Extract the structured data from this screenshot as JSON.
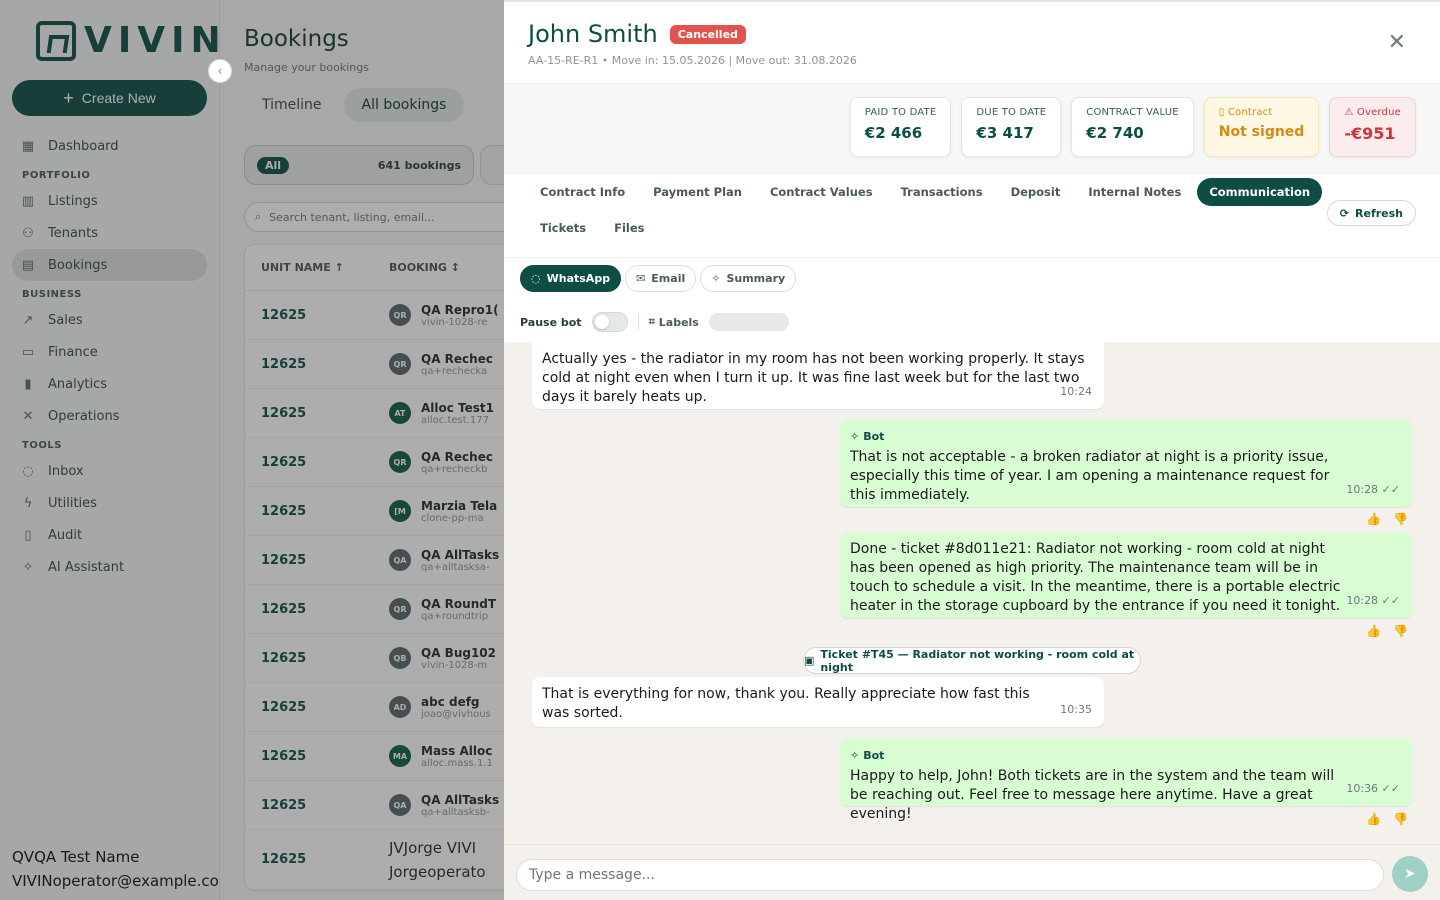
{
  "app": {
    "logo_text": "VIVIN"
  },
  "sidebar": {
    "create_label": "Create New",
    "items": [
      {
        "label": "Dashboard",
        "icon": "grid-icon"
      },
      {
        "section": "PORTFOLIO"
      },
      {
        "label": "Listings",
        "icon": "building-icon"
      },
      {
        "label": "Tenants",
        "icon": "users-icon"
      },
      {
        "label": "Bookings",
        "icon": "calendar-icon",
        "active": true
      },
      {
        "section": "BUSINESS"
      },
      {
        "label": "Sales",
        "icon": "trend-icon"
      },
      {
        "label": "Finance",
        "icon": "wallet-icon"
      },
      {
        "label": "Analytics",
        "icon": "chart-icon"
      },
      {
        "label": "Operations",
        "icon": "tools-icon"
      },
      {
        "section": "TOOLS"
      },
      {
        "label": "Inbox",
        "icon": "chat-icon"
      },
      {
        "label": "Utilities",
        "icon": "bolt-icon"
      },
      {
        "label": "Audit",
        "icon": "clipboard-icon"
      },
      {
        "label": "AI Assistant",
        "icon": "sparkle-chat-icon"
      }
    ],
    "user": {
      "name": "QVQA Test Name",
      "email": "VIVINoperator@example.com"
    }
  },
  "bookings": {
    "title": "Bookings",
    "subtitle": "Manage your bookings",
    "view_tabs": [
      "Timeline",
      "All bookings"
    ],
    "filter": {
      "chip": "All",
      "count": "641 bookings"
    },
    "search_placeholder": "Search tenant, listing, email...",
    "columns": {
      "unit": "UNIT NAME ↑",
      "booking": "BOOKING ↕"
    },
    "rows": [
      {
        "unit": "12625",
        "initials": "QR",
        "name": "QA Repro1(",
        "email": "vivin-1028-re"
      },
      {
        "unit": "12625",
        "initials": "QR",
        "name": "QA Rechec",
        "email": "qa+rechecka"
      },
      {
        "unit": "12625",
        "initials": "AT",
        "name": "Alloc Test1",
        "email": "alloc.test.177",
        "green": true
      },
      {
        "unit": "12625",
        "initials": "QR",
        "name": "QA Rechec",
        "email": "qa+recheckb",
        "green": true
      },
      {
        "unit": "12625",
        "initials": "[M",
        "name": "Marzia Tela",
        "email": "clone-pp-ma",
        "green": true
      },
      {
        "unit": "12625",
        "initials": "QA",
        "name": "QA AllTasks",
        "email": "qa+alltasksa-"
      },
      {
        "unit": "12625",
        "initials": "QR",
        "name": "QA RoundT",
        "email": "qa+roundtrip"
      },
      {
        "unit": "12625",
        "initials": "QB",
        "name": "QA Bug102",
        "email": "vivin-1028-m"
      },
      {
        "unit": "12625",
        "initials": "AD",
        "name": "abc defg",
        "email": "joao@vivhous"
      },
      {
        "unit": "12625",
        "initials": "MA",
        "name": "Mass Alloc",
        "email": "alloc.mass.1.1",
        "green": true
      },
      {
        "unit": "12625",
        "initials": "QA",
        "name": "QA AllTasks",
        "email": "qa+alltasksb-"
      }
    ],
    "last_row": {
      "unit": "12625",
      "name": "JVJorge VIVI",
      "email": "Jorgeoperato"
    }
  },
  "drawer": {
    "name": "John Smith",
    "status": "Cancelled",
    "meta": "AA-15-RE-R1 • Move in: 15.05.2026 | Move out: 31.08.2026",
    "cards": [
      {
        "label": "PAID TO DATE",
        "value": "€2 466"
      },
      {
        "label": "DUE TO DATE",
        "value": "€3 417"
      },
      {
        "label": "CONTRACT VALUE",
        "value": "€2 740"
      },
      {
        "label": "Contract",
        "value": "Not signed",
        "kind": "warn"
      },
      {
        "label": "Overdue",
        "value": "-€951",
        "kind": "danger"
      }
    ],
    "tabs_row1": [
      "Contract Info",
      "Payment Plan",
      "Contract Values",
      "Transactions",
      "Deposit",
      "Internal Notes",
      "Communication"
    ],
    "tabs_row2": [
      "Tickets",
      "Files"
    ],
    "active_tab": "Communication",
    "refresh_label": "Refresh",
    "channels": [
      "WhatsApp",
      "Email",
      "Summary"
    ],
    "pause_bot_label": "Pause bot",
    "labels_label": "Labels",
    "messages": [
      {
        "dir": "in",
        "text": "Actually yes - the radiator in my room has not been working properly. It stays cold at night even when I turn it up. It was fine last week but for the last two days it barely heats up.",
        "time": "10:24"
      },
      {
        "dir": "out",
        "sender": "Bot",
        "text": "That is not acceptable - a broken radiator at night is a priority issue, especially this time of year. I am opening a maintenance request for this immediately.",
        "time": "10:28 ✓✓"
      },
      {
        "dir": "out",
        "text": "Done - ticket #8d011e21: Radiator not working - room cold at night has been opened as high priority. The maintenance team will be in touch to schedule a visit. In the meantime, there is a portable electric heater in the storage cupboard by the entrance if you need it tonight.",
        "time": "10:28 ✓✓"
      },
      {
        "dir": "in",
        "text": "That is everything for now, thank you. Really appreciate how fast this was sorted.",
        "time": "10:35"
      },
      {
        "dir": "out",
        "sender": "Bot",
        "text": "Happy to help, John! Both tickets are in the system and the team will be reaching out. Feel free to message here anytime. Have a great evening!",
        "time": "10:36 ✓✓"
      }
    ],
    "ticket_chip": "Ticket #T45 — Radiator not working - room cold at night",
    "composer_placeholder": "Type a message..."
  }
}
